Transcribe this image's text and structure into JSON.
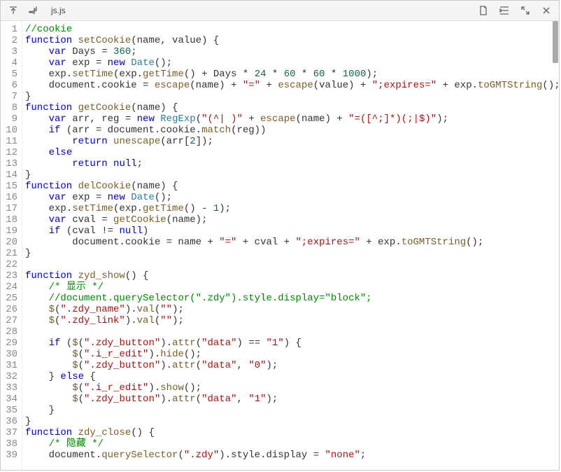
{
  "toolbar": {
    "tab_filename": "js.js"
  },
  "icons": {
    "jump_top": "jump-top-icon",
    "pin": "pin-icon",
    "new_file": "new-file-icon",
    "indent": "indent-icon",
    "expand": "expand-icon",
    "close": "close-icon"
  },
  "code": {
    "lines": [
      {
        "n": 1,
        "tokens": [
          [
            "comment",
            "//cookie"
          ]
        ]
      },
      {
        "n": 2,
        "tokens": [
          [
            "keyword",
            "function"
          ],
          [
            "plain",
            " "
          ],
          [
            "func",
            "setCookie"
          ],
          [
            "plain",
            "(name, value) {"
          ]
        ]
      },
      {
        "n": 3,
        "tokens": [
          [
            "plain",
            "    "
          ],
          [
            "keyword",
            "var"
          ],
          [
            "plain",
            " Days = "
          ],
          [
            "number",
            "360"
          ],
          [
            "plain",
            ";"
          ]
        ]
      },
      {
        "n": 4,
        "tokens": [
          [
            "plain",
            "    "
          ],
          [
            "keyword",
            "var"
          ],
          [
            "plain",
            " exp = "
          ],
          [
            "keyword",
            "new"
          ],
          [
            "plain",
            " "
          ],
          [
            "class",
            "Date"
          ],
          [
            "plain",
            "();"
          ]
        ]
      },
      {
        "n": 5,
        "tokens": [
          [
            "plain",
            "    exp."
          ],
          [
            "func",
            "setTime"
          ],
          [
            "plain",
            "(exp."
          ],
          [
            "func",
            "getTime"
          ],
          [
            "plain",
            "() + Days * "
          ],
          [
            "number",
            "24"
          ],
          [
            "plain",
            " * "
          ],
          [
            "number",
            "60"
          ],
          [
            "plain",
            " * "
          ],
          [
            "number",
            "60"
          ],
          [
            "plain",
            " * "
          ],
          [
            "number",
            "1000"
          ],
          [
            "plain",
            ");"
          ]
        ]
      },
      {
        "n": 6,
        "tokens": [
          [
            "plain",
            "    document.cookie = "
          ],
          [
            "func",
            "escape"
          ],
          [
            "plain",
            "(name) + "
          ],
          [
            "string",
            "\"=\""
          ],
          [
            "plain",
            " + "
          ],
          [
            "func",
            "escape"
          ],
          [
            "plain",
            "(value) + "
          ],
          [
            "string",
            "\";expires=\""
          ],
          [
            "plain",
            " + exp."
          ],
          [
            "func",
            "toGMTString"
          ],
          [
            "plain",
            "();"
          ]
        ]
      },
      {
        "n": 7,
        "tokens": [
          [
            "plain",
            "}"
          ]
        ]
      },
      {
        "n": 8,
        "tokens": [
          [
            "keyword",
            "function"
          ],
          [
            "plain",
            " "
          ],
          [
            "func",
            "getCookie"
          ],
          [
            "plain",
            "(name) {"
          ]
        ]
      },
      {
        "n": 9,
        "tokens": [
          [
            "plain",
            "    "
          ],
          [
            "keyword",
            "var"
          ],
          [
            "plain",
            " arr, reg = "
          ],
          [
            "keyword",
            "new"
          ],
          [
            "plain",
            " "
          ],
          [
            "class",
            "RegExp"
          ],
          [
            "plain",
            "("
          ],
          [
            "string",
            "\"(^| )\""
          ],
          [
            "plain",
            " + "
          ],
          [
            "func",
            "escape"
          ],
          [
            "plain",
            "(name) + "
          ],
          [
            "string",
            "\"=([^;]*)(;|$)\""
          ],
          [
            "plain",
            ");"
          ]
        ]
      },
      {
        "n": 10,
        "tokens": [
          [
            "plain",
            "    "
          ],
          [
            "keyword",
            "if"
          ],
          [
            "plain",
            " (arr = document.cookie."
          ],
          [
            "func",
            "match"
          ],
          [
            "plain",
            "(reg))"
          ]
        ]
      },
      {
        "n": 11,
        "tokens": [
          [
            "plain",
            "        "
          ],
          [
            "keyword",
            "return"
          ],
          [
            "plain",
            " "
          ],
          [
            "func",
            "unescape"
          ],
          [
            "plain",
            "(arr["
          ],
          [
            "number",
            "2"
          ],
          [
            "plain",
            "]);"
          ]
        ]
      },
      {
        "n": 12,
        "tokens": [
          [
            "plain",
            "    "
          ],
          [
            "keyword",
            "else"
          ]
        ]
      },
      {
        "n": 13,
        "tokens": [
          [
            "plain",
            "        "
          ],
          [
            "keyword",
            "return"
          ],
          [
            "plain",
            " "
          ],
          [
            "null",
            "null"
          ],
          [
            "plain",
            ";"
          ]
        ]
      },
      {
        "n": 14,
        "tokens": [
          [
            "plain",
            "}"
          ]
        ]
      },
      {
        "n": 15,
        "tokens": [
          [
            "keyword",
            "function"
          ],
          [
            "plain",
            " "
          ],
          [
            "func",
            "delCookie"
          ],
          [
            "plain",
            "(name) {"
          ]
        ]
      },
      {
        "n": 16,
        "tokens": [
          [
            "plain",
            "    "
          ],
          [
            "keyword",
            "var"
          ],
          [
            "plain",
            " exp = "
          ],
          [
            "keyword",
            "new"
          ],
          [
            "plain",
            " "
          ],
          [
            "class",
            "Date"
          ],
          [
            "plain",
            "();"
          ]
        ]
      },
      {
        "n": 17,
        "tokens": [
          [
            "plain",
            "    exp."
          ],
          [
            "func",
            "setTime"
          ],
          [
            "plain",
            "(exp."
          ],
          [
            "func",
            "getTime"
          ],
          [
            "plain",
            "() - "
          ],
          [
            "number",
            "1"
          ],
          [
            "plain",
            ");"
          ]
        ]
      },
      {
        "n": 18,
        "tokens": [
          [
            "plain",
            "    "
          ],
          [
            "keyword",
            "var"
          ],
          [
            "plain",
            " cval = "
          ],
          [
            "func",
            "getCookie"
          ],
          [
            "plain",
            "(name);"
          ]
        ]
      },
      {
        "n": 19,
        "tokens": [
          [
            "plain",
            "    "
          ],
          [
            "keyword",
            "if"
          ],
          [
            "plain",
            " (cval != "
          ],
          [
            "null",
            "null"
          ],
          [
            "plain",
            ")"
          ]
        ]
      },
      {
        "n": 20,
        "tokens": [
          [
            "plain",
            "        document.cookie = name + "
          ],
          [
            "string",
            "\"=\""
          ],
          [
            "plain",
            " + cval + "
          ],
          [
            "string",
            "\";expires=\""
          ],
          [
            "plain",
            " + exp."
          ],
          [
            "func",
            "toGMTString"
          ],
          [
            "plain",
            "();"
          ]
        ]
      },
      {
        "n": 21,
        "tokens": [
          [
            "plain",
            "}"
          ]
        ]
      },
      {
        "n": 22,
        "tokens": [
          [
            "plain",
            ""
          ]
        ]
      },
      {
        "n": 23,
        "tokens": [
          [
            "keyword",
            "function"
          ],
          [
            "plain",
            " "
          ],
          [
            "func",
            "zyd_show"
          ],
          [
            "plain",
            "() {"
          ]
        ]
      },
      {
        "n": 24,
        "tokens": [
          [
            "plain",
            "    "
          ],
          [
            "comment",
            "/* 显示 */"
          ]
        ]
      },
      {
        "n": 25,
        "tokens": [
          [
            "plain",
            "    "
          ],
          [
            "comment",
            "//document.querySelector(\".zdy\").style.display=\"block\";"
          ]
        ]
      },
      {
        "n": 26,
        "tokens": [
          [
            "plain",
            "    "
          ],
          [
            "func",
            "$"
          ],
          [
            "plain",
            "("
          ],
          [
            "string",
            "\".zdy_name\""
          ],
          [
            "plain",
            "])."
          ],
          [
            "func",
            "val"
          ],
          [
            "plain",
            "("
          ],
          [
            "string",
            "\"\""
          ],
          [
            "plain",
            ");"
          ]
        ]
      },
      {
        "n": 27,
        "tokens": [
          [
            "plain",
            "    "
          ],
          [
            "func",
            "$"
          ],
          [
            "plain",
            "("
          ],
          [
            "string",
            "\".zdy_link\""
          ],
          [
            "plain",
            "])."
          ],
          [
            "func",
            "val"
          ],
          [
            "plain",
            "("
          ],
          [
            "string",
            "\"\""
          ],
          [
            "plain",
            ");"
          ]
        ]
      },
      {
        "n": 28,
        "tokens": [
          [
            "plain",
            ""
          ]
        ]
      },
      {
        "n": 29,
        "tokens": [
          [
            "plain",
            "    "
          ],
          [
            "keyword",
            "if"
          ],
          [
            "plain",
            " ("
          ],
          [
            "func",
            "$"
          ],
          [
            "plain",
            "("
          ],
          [
            "string",
            "\".zdy_button\""
          ],
          [
            "plain",
            "])."
          ],
          [
            "func",
            "attr"
          ],
          [
            "plain",
            "("
          ],
          [
            "string",
            "\"data\""
          ],
          [
            "plain",
            ") == "
          ],
          [
            "string",
            "\"1\""
          ],
          [
            "plain",
            ") {"
          ]
        ]
      },
      {
        "n": 30,
        "tokens": [
          [
            "plain",
            "        "
          ],
          [
            "func",
            "$"
          ],
          [
            "plain",
            "("
          ],
          [
            "string",
            "\".i_r_edit\""
          ],
          [
            "plain",
            "])."
          ],
          [
            "func",
            "hide"
          ],
          [
            "plain",
            "();"
          ]
        ]
      },
      {
        "n": 31,
        "tokens": [
          [
            "plain",
            "        "
          ],
          [
            "func",
            "$"
          ],
          [
            "plain",
            "("
          ],
          [
            "string",
            "\".zdy_button\""
          ],
          [
            "plain",
            "])."
          ],
          [
            "func",
            "attr"
          ],
          [
            "plain",
            "("
          ],
          [
            "string",
            "\"data\""
          ],
          [
            "plain",
            ", "
          ],
          [
            "string",
            "\"0\""
          ],
          [
            "plain",
            ");"
          ]
        ]
      },
      {
        "n": 32,
        "tokens": [
          [
            "plain",
            "    } "
          ],
          [
            "keyword",
            "else"
          ],
          [
            "plain",
            " {"
          ]
        ]
      },
      {
        "n": 33,
        "tokens": [
          [
            "plain",
            "        "
          ],
          [
            "func",
            "$"
          ],
          [
            "plain",
            "("
          ],
          [
            "string",
            "\".i_r_edit\""
          ],
          [
            "plain",
            "])."
          ],
          [
            "func",
            "show"
          ],
          [
            "plain",
            "();"
          ]
        ]
      },
      {
        "n": 34,
        "tokens": [
          [
            "plain",
            "        "
          ],
          [
            "func",
            "$"
          ],
          [
            "plain",
            "("
          ],
          [
            "string",
            "\".zdy_button\""
          ],
          [
            "plain",
            "])."
          ],
          [
            "func",
            "attr"
          ],
          [
            "plain",
            "("
          ],
          [
            "string",
            "\"data\""
          ],
          [
            "plain",
            ", "
          ],
          [
            "string",
            "\"1\""
          ],
          [
            "plain",
            ");"
          ]
        ]
      },
      {
        "n": 35,
        "tokens": [
          [
            "plain",
            "    }"
          ]
        ]
      },
      {
        "n": 36,
        "tokens": [
          [
            "plain",
            "}"
          ]
        ]
      },
      {
        "n": 37,
        "tokens": [
          [
            "keyword",
            "function"
          ],
          [
            "plain",
            " "
          ],
          [
            "func",
            "zdy_close"
          ],
          [
            "plain",
            "() {"
          ]
        ]
      },
      {
        "n": 38,
        "tokens": [
          [
            "plain",
            "    "
          ],
          [
            "comment",
            "/* 隐藏 */"
          ]
        ]
      },
      {
        "n": 39,
        "tokens": [
          [
            "plain",
            "    document."
          ],
          [
            "func",
            "querySelector"
          ],
          [
            "plain",
            "("
          ],
          [
            "string",
            "\".zdy\""
          ],
          [
            "plain",
            ").style.display = "
          ],
          [
            "string",
            "\"none\""
          ],
          [
            "plain",
            ";"
          ]
        ]
      }
    ]
  }
}
